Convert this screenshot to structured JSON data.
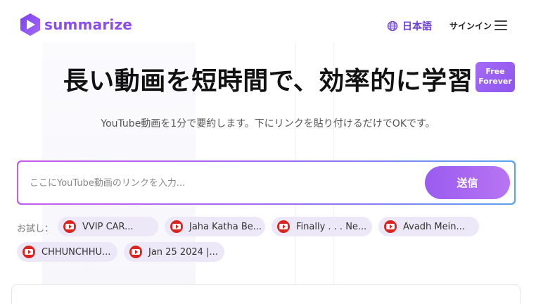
{
  "brand": {
    "name": "summarize",
    "accent": "#8a4df2"
  },
  "header": {
    "language_label": "日本語",
    "signin_label": "サインイン",
    "globe_icon": "globe-icon",
    "menu_icon": "hamburger-menu-icon"
  },
  "hero": {
    "title": "長い動画を短時間で、効率的に学習",
    "badge_line1": "Free",
    "badge_line2": "Forever",
    "subtitle": "YouTube動画を1分で要約します。下にリンクを貼り付けるだけでOKです。"
  },
  "search": {
    "placeholder": "ここにYouTube動画のリンクを入力...",
    "value": "",
    "submit_label": "送信"
  },
  "samples": {
    "label": "お試し：",
    "items": [
      {
        "label": "VVIP CAR..."
      },
      {
        "label": "Jaha Katha Be..."
      },
      {
        "label": "Finally . . . Ne..."
      },
      {
        "label": "Avadh Mein..."
      },
      {
        "label": "CHHUNCHHU..."
      },
      {
        "label": "Jan 25 2024 |..."
      }
    ]
  }
}
